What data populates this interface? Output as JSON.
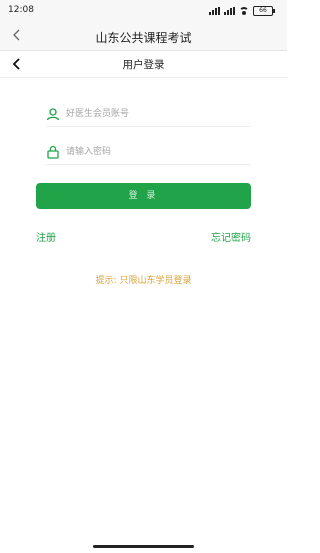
{
  "status_bar": {
    "time": "12:08",
    "battery": "66"
  },
  "app_bar": {
    "title": "山东公共课程考试"
  },
  "nav_bar": {
    "title": "用户登录"
  },
  "form": {
    "account_placeholder": "好医生会员账号",
    "password_placeholder": "请输入密码",
    "login_label": "登 录"
  },
  "links": {
    "register": "注册",
    "forgot_password": "忘记密码"
  },
  "hint": "提示: 只限山东学员登录",
  "colors": {
    "primary": "#21a34a",
    "hint": "#dba13a"
  },
  "icons": {
    "app_back": "chevron-left-icon",
    "nav_back": "chevron-left-icon",
    "account": "user-icon",
    "password": "lock-icon"
  }
}
